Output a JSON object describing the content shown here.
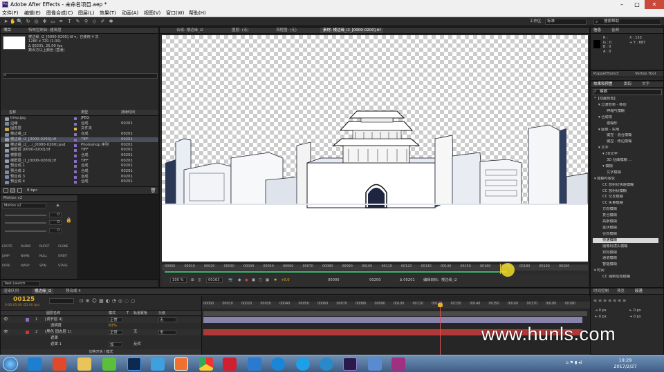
{
  "window": {
    "title": "Adobe After Effects - 未命名项目.aep *",
    "min": "–",
    "max": "□",
    "close": "✕"
  },
  "menu": [
    "文件(F)",
    "编辑(E)",
    "图像合成(C)",
    "图层(L)",
    "效果(T)",
    "动画(A)",
    "视图(V)",
    "窗口(W)",
    "帮助(H)"
  ],
  "toolbar": {
    "workspace_label": "工作区",
    "workspace_value": "标准",
    "search_placeholder": "搜索帮助"
  },
  "project": {
    "tabs": [
      "项目",
      "特效控制台: 建筑层"
    ],
    "info": [
      "楼边缘_i2_[0000-0200].tif ▾，已使用 4 次",
      "1280 x 720 (1.00)",
      "Δ 00201, 25.00 fps",
      "数百万以上颜色 (直通)"
    ],
    "search_placeholder": "",
    "cols": [
      "名称",
      "类型",
      "持续时间"
    ],
    "rows": [
      {
        "name": "timp.jpg",
        "type": "JPEG",
        "dur": "",
        "icon": "img",
        "color": "#8a6fc9",
        "sel": false
      },
      {
        "name": "边缘",
        "type": "合成",
        "dur": "00201",
        "icon": "comp",
        "color": "#8a6fc9",
        "sel": false
      },
      {
        "name": "固态层",
        "type": "文件夹",
        "dur": "",
        "icon": "folder",
        "color": "#d8c04a",
        "sel": false
      },
      {
        "name": "楼边缘_i2",
        "type": "合成",
        "dur": "00201",
        "icon": "comp",
        "color": "#8a6fc9",
        "sel": false
      },
      {
        "name": "楼边缘_i2_[0000-0200].tif",
        "type": "TIFF",
        "dur": "00201",
        "icon": "img",
        "color": "#8a6fc9",
        "sel": true
      },
      {
        "name": "楼边缘_i2_...i_[0000-0200].psd",
        "type": "Photoshop 序列",
        "dur": "00201",
        "icon": "img",
        "color": "#8a6fc9",
        "sel": false
      },
      {
        "name": "楼群层 [0000-0200].tif",
        "type": "TIFF",
        "dur": "00201",
        "icon": "img",
        "color": "#8a6fc9",
        "sel": false
      },
      {
        "name": "楼群层",
        "type": "合成",
        "dur": "00201",
        "icon": "comp",
        "color": "#8a6fc9",
        "sel": false
      },
      {
        "name": "楼群层_i1_[0000-0200].tif",
        "type": "TIFF",
        "dur": "00201",
        "icon": "img",
        "color": "#8a6fc9",
        "sel": false
      },
      {
        "name": "预合成 1",
        "type": "合成",
        "dur": "00201",
        "icon": "comp",
        "color": "#8a6fc9",
        "sel": false
      },
      {
        "name": "预合成 2",
        "type": "合成",
        "dur": "00201",
        "icon": "comp",
        "color": "#8a6fc9",
        "sel": false
      },
      {
        "name": "预合成 3",
        "type": "合成",
        "dur": "00201",
        "icon": "comp",
        "color": "#8a6fc9",
        "sel": false
      },
      {
        "name": "预合成 4",
        "type": "合成",
        "dur": "00201",
        "icon": "comp",
        "color": "#8a6fc9",
        "sel": false
      }
    ],
    "bpc": "8 bpc"
  },
  "motion": {
    "tab": "Motion v2",
    "preset": "Motion v2",
    "val1": "0",
    "val2": "0",
    "val3": "0",
    "buttons": [
      "EXCITE",
      "BLEND",
      "BURST",
      "CLONE",
      "JUMP",
      "NAME",
      "NULL",
      "ORBIT",
      "ROPE",
      "WARP",
      "SPIN",
      "STARE"
    ]
  },
  "task": {
    "label": "Task Launch"
  },
  "viewer": {
    "tabs": [
      "合成: 楼边缘_i2",
      "图层: (无)",
      "流程图: (无)",
      "素材: 楼边缘_i2_[0000-0200].tif"
    ],
    "active_tab": 3,
    "ruler": [
      "00000",
      "00010",
      "00020",
      "00030",
      "00040",
      "00050",
      "00060",
      "00070",
      "00080",
      "00090",
      "00100",
      "00110",
      "00120",
      "00130",
      "00140",
      "00150",
      "00160",
      "00170",
      "00180",
      "00190",
      "00200"
    ],
    "zoom": "100 %",
    "frame": "00163",
    "fps_val": "+0.0",
    "in": "00000",
    "out": "00200",
    "dur": "Δ 00201",
    "edit_target": "编辑目标：楼边缘_i2"
  },
  "info_panel": {
    "tabs": [
      "信息",
      "音频"
    ],
    "r": "R :",
    "g": "G : 0",
    "b": "B : 0",
    "a": "A : 0",
    "x": "X : 153",
    "y": "+ Y : 687"
  },
  "puppet": {
    "tabs": [
      "PuppetTools3",
      "Vertex Tool"
    ]
  },
  "effects": {
    "tabs": [
      "效果和预置",
      "跟踪",
      "文字"
    ],
    "search": "模糊",
    "items": [
      {
        "t": "*【动画预置】",
        "lvl": 0
      },
      {
        "t": "▾ 过渡效果 - 移动",
        "lvl": 1
      },
      {
        "t": "伸缩与模糊",
        "lvl": 3
      },
      {
        "t": "▾ 合成物",
        "lvl": 1
      },
      {
        "t": "模糊形",
        "lvl": 3
      },
      {
        "t": "▾ 图像 - 实用",
        "lvl": 1
      },
      {
        "t": "键控 - 混合模糊",
        "lvl": 3
      },
      {
        "t": "键控 - 修边模糊",
        "lvl": 3
      },
      {
        "t": "▾ 文字",
        "lvl": 1
      },
      {
        "t": "▾ 3D文字",
        "lvl": 2
      },
      {
        "t": "3D 扭曲模糊 ...",
        "lvl": 3
      },
      {
        "t": "▾ 模糊",
        "lvl": 2
      },
      {
        "t": "文字模糊",
        "lvl": 3
      },
      {
        "t": "▾ 模糊与锐化",
        "lvl": 0
      },
      {
        "t": "CC 放射状快速模糊",
        "lvl": 2
      },
      {
        "t": "CC 放射状模糊",
        "lvl": 2
      },
      {
        "t": "CC 交叉模糊",
        "lvl": 2
      },
      {
        "t": "CC 矢量模糊",
        "lvl": 2
      },
      {
        "t": "方向模糊",
        "lvl": 2
      },
      {
        "t": "复合模糊",
        "lvl": 2
      },
      {
        "t": "高斯模糊",
        "lvl": 2
      },
      {
        "t": "盒状模糊",
        "lvl": 2
      },
      {
        "t": "径向模糊",
        "lvl": 2
      },
      {
        "t": "快速模糊",
        "lvl": 2,
        "sel": true
      },
      {
        "t": "摄像机镜头模糊",
        "lvl": 2
      },
      {
        "t": "双向模糊",
        "lvl": 2
      },
      {
        "t": "通道模糊",
        "lvl": 2
      },
      {
        "t": "智能模糊",
        "lvl": 2
      },
      {
        "t": "▾ 时间",
        "lvl": 0
      },
      {
        "t": "CC 强制动态模糊",
        "lvl": 2
      }
    ]
  },
  "timeline": {
    "tabs": [
      "渲染队列",
      "楼边缘_i2",
      "预合成 4"
    ],
    "timecode": "00125",
    "timecode_sub": "0:00:05:00 (25.00 fps)",
    "cols": [
      "图层名称",
      "模式",
      "T",
      "轨道蒙板",
      "父级"
    ],
    "layers": [
      {
        "num": "1",
        "name": "[调节层 4]",
        "mode": "正常",
        "mat": "",
        "parent": "无",
        "color": "#8a6fc9",
        "bar": "#a09bd0"
      },
      {
        "num": "",
        "name": "透明度",
        "mode": "",
        "mat": "",
        "parent": "",
        "color": "",
        "bar": "",
        "prop": "63%"
      },
      {
        "num": "2",
        "name": "[黑色 固态层 1]",
        "mode": "正常",
        "mat": "无",
        "parent": "无",
        "color": "#c43a3a",
        "bar": "#b03838"
      },
      {
        "num": "",
        "name": "遮罩",
        "mode": "",
        "mat": "",
        "parent": "",
        "color": "",
        "bar": ""
      },
      {
        "num": "",
        "name": "遮罩 1",
        "mode": "加",
        "mat": "反转",
        "parent": "",
        "color": "",
        "bar": ""
      }
    ],
    "ruler": [
      "00000",
      "00010",
      "00020",
      "00030",
      "00040",
      "00050",
      "00060",
      "00070",
      "00080",
      "00090",
      "00100",
      "00110",
      "00120",
      "00130",
      "00140",
      "00150",
      "00160",
      "00170",
      "00180",
      "00190"
    ],
    "toggle": "切换开关 / 模式"
  },
  "preview": {
    "tabs": [
      "时间控制",
      "预览",
      "段落"
    ],
    "px1": "0 px",
    "px2": "0 px",
    "px3": "0 px",
    "px4": "0 px"
  },
  "watermark": "www.hunls.com",
  "clock": {
    "time": "19:29",
    "date": "2017/2/27"
  }
}
